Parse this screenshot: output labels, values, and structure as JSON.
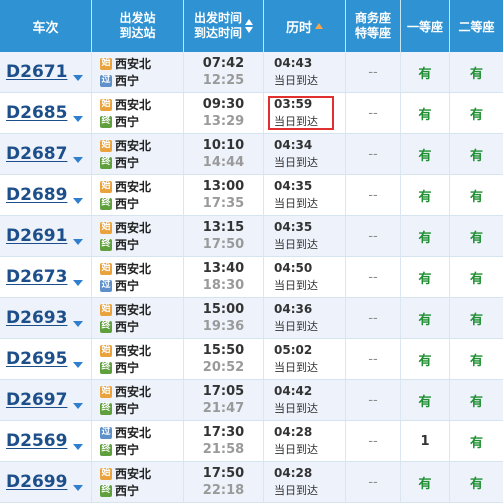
{
  "header": {
    "train": "车次",
    "stations_top": "出发站",
    "stations_bottom": "到达站",
    "times_top": "出发时间",
    "times_bottom": "到达时间",
    "duration": "历时",
    "business_top": "商务座",
    "business_bottom": "特等座",
    "first_class": "一等座",
    "second_class": "二等座"
  },
  "badges": {
    "start": "始",
    "pass": "过",
    "end": "终"
  },
  "rows": [
    {
      "train": "D2671",
      "from_badge": "始",
      "from": "西安北",
      "to_badge": "过",
      "to": "西宁",
      "dep": "07:42",
      "arr": "12:25",
      "duration": "04:43",
      "note": "当日到达",
      "business": "--",
      "first": "有",
      "second": "有"
    },
    {
      "train": "D2685",
      "from_badge": "始",
      "from": "西安北",
      "to_badge": "终",
      "to": "西宁",
      "dep": "09:30",
      "arr": "13:29",
      "duration": "03:59",
      "note": "当日到达",
      "business": "--",
      "first": "有",
      "second": "有"
    },
    {
      "train": "D2687",
      "from_badge": "始",
      "from": "西安北",
      "to_badge": "终",
      "to": "西宁",
      "dep": "10:10",
      "arr": "14:44",
      "duration": "04:34",
      "note": "当日到达",
      "business": "--",
      "first": "有",
      "second": "有"
    },
    {
      "train": "D2689",
      "from_badge": "始",
      "from": "西安北",
      "to_badge": "终",
      "to": "西宁",
      "dep": "13:00",
      "arr": "17:35",
      "duration": "04:35",
      "note": "当日到达",
      "business": "--",
      "first": "有",
      "second": "有"
    },
    {
      "train": "D2691",
      "from_badge": "始",
      "from": "西安北",
      "to_badge": "终",
      "to": "西宁",
      "dep": "13:15",
      "arr": "17:50",
      "duration": "04:35",
      "note": "当日到达",
      "business": "--",
      "first": "有",
      "second": "有"
    },
    {
      "train": "D2673",
      "from_badge": "始",
      "from": "西安北",
      "to_badge": "过",
      "to": "西宁",
      "dep": "13:40",
      "arr": "18:30",
      "duration": "04:50",
      "note": "当日到达",
      "business": "--",
      "first": "有",
      "second": "有"
    },
    {
      "train": "D2693",
      "from_badge": "始",
      "from": "西安北",
      "to_badge": "终",
      "to": "西宁",
      "dep": "15:00",
      "arr": "19:36",
      "duration": "04:36",
      "note": "当日到达",
      "business": "--",
      "first": "有",
      "second": "有"
    },
    {
      "train": "D2695",
      "from_badge": "始",
      "from": "西安北",
      "to_badge": "终",
      "to": "西宁",
      "dep": "15:50",
      "arr": "20:52",
      "duration": "05:02",
      "note": "当日到达",
      "business": "--",
      "first": "有",
      "second": "有"
    },
    {
      "train": "D2697",
      "from_badge": "始",
      "from": "西安北",
      "to_badge": "终",
      "to": "西宁",
      "dep": "17:05",
      "arr": "21:47",
      "duration": "04:42",
      "note": "当日到达",
      "business": "--",
      "first": "有",
      "second": "有"
    },
    {
      "train": "D2569",
      "from_badge": "过",
      "from": "西安北",
      "to_badge": "终",
      "to": "西宁",
      "dep": "17:30",
      "arr": "21:58",
      "duration": "04:28",
      "note": "当日到达",
      "business": "--",
      "first": "1",
      "second": "有"
    },
    {
      "train": "D2699",
      "from_badge": "始",
      "from": "西安北",
      "to_badge": "终",
      "to": "西宁",
      "dep": "17:50",
      "arr": "22:18",
      "duration": "04:28",
      "note": "当日到达",
      "business": "--",
      "first": "有",
      "second": "有"
    }
  ],
  "highlighted_row": "D2685",
  "colors": {
    "header_bg": "#2f92d2",
    "highlight": "#e0302f",
    "available": "#1f8f32"
  }
}
